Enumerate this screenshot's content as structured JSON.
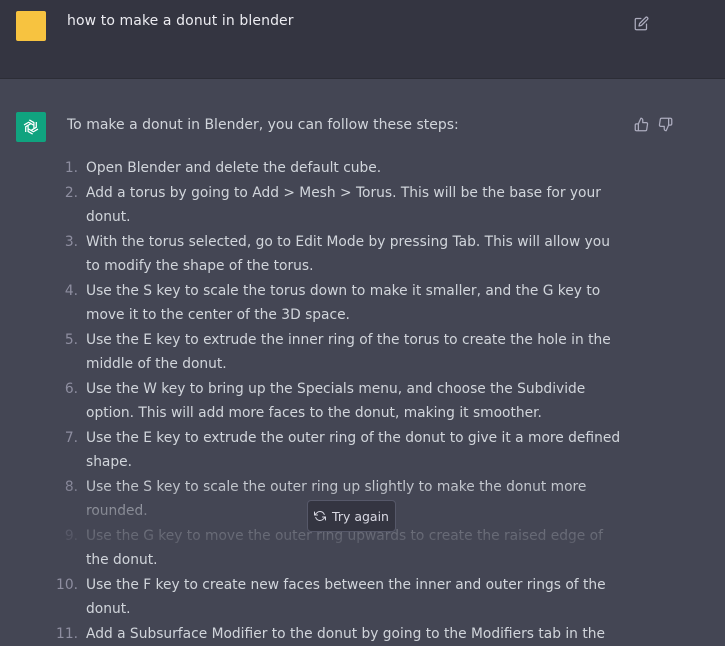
{
  "user_message": {
    "text": "how to make a donut in blender",
    "avatar_color": "#f7c340",
    "edit_icon": "edit-icon"
  },
  "assistant_message": {
    "intro": "To make a donut in Blender, you can follow these steps:",
    "avatar_color": "#10a37f",
    "avatar_icon": "openai-logo-icon",
    "steps": [
      {
        "num": "1.",
        "text": "Open Blender and delete the default cube."
      },
      {
        "num": "2.",
        "text": "Add a torus by going to Add > Mesh > Torus. This will be the base for your donut."
      },
      {
        "num": "3.",
        "text": "With the torus selected, go to Edit Mode by pressing Tab. This will allow you to modify the shape of the torus."
      },
      {
        "num": "4.",
        "text": "Use the S key to scale the torus down to make it smaller, and the G key to move it to the center of the 3D space."
      },
      {
        "num": "5.",
        "text": "Use the E key to extrude the inner ring of the torus to create the hole in the middle of the donut."
      },
      {
        "num": "6.",
        "text": "Use the W key to bring up the Specials menu, and choose the Subdivide option. This will add more faces to the donut, making it smoother."
      },
      {
        "num": "7.",
        "text": "Use the E key to extrude the outer ring of the donut to give it a more defined shape."
      },
      {
        "num": "8.",
        "text": "Use the S key to scale the outer ring up slightly to make the donut more rounded."
      },
      {
        "num": "9.",
        "text": "Use the G key to move the outer ring upwards to create the raised edge of the donut."
      },
      {
        "num": "10.",
        "text": "Use the F key to create new faces between the inner and outer rings of the donut."
      },
      {
        "num": "11.",
        "text": "Add a Subsurface Modifier to the donut by going to the Modifiers tab in the"
      }
    ],
    "feedback_icons": [
      "thumbs-up-icon",
      "thumbs-down-icon"
    ]
  },
  "try_again": {
    "label": "Try again",
    "icon": "refresh-icon"
  }
}
